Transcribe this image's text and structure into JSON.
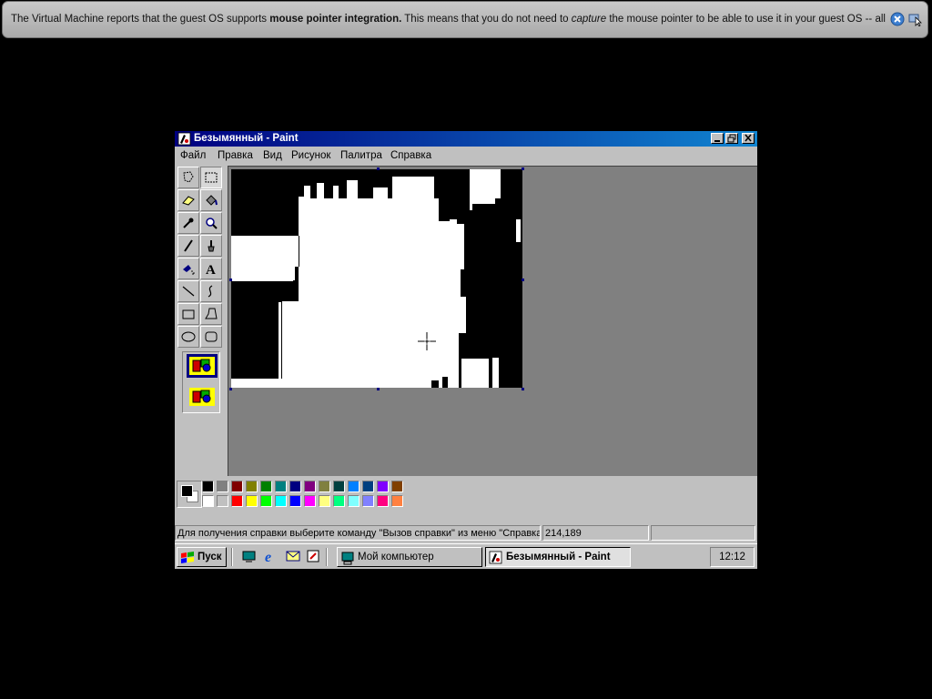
{
  "notification": {
    "part1": "The Virtual Machine reports that the guest OS supports ",
    "bold": "mouse pointer integration.",
    "part2": " This means that you do not need to ",
    "italic": "capture",
    "part3": " the mouse pointer to be able to use it in your guest OS -- all mouse"
  },
  "window": {
    "title": "Безымянный - Paint"
  },
  "menu": {
    "file": "Файл",
    "edit": "Правка",
    "view": "Вид",
    "image": "Рисунок",
    "palette": "Палитра",
    "help": "Справка"
  },
  "tools": [
    "free-select",
    "rect-select",
    "eraser",
    "fill",
    "color-picker",
    "magnifier",
    "pencil",
    "brush",
    "airbrush",
    "text",
    "line",
    "curve",
    "rectangle",
    "polygon",
    "ellipse",
    "rounded-rectangle"
  ],
  "palette": {
    "row1": [
      "#000000",
      "#808080",
      "#800000",
      "#808000",
      "#008000",
      "#008080",
      "#000080",
      "#800080",
      "#808040",
      "#004040",
      "#0080ff",
      "#004080",
      "#8000ff",
      "#804000"
    ],
    "row2": [
      "#ffffff",
      "#c0c0c0",
      "#ff0000",
      "#ffff00",
      "#00ff00",
      "#00ffff",
      "#0000ff",
      "#ff00ff",
      "#ffff80",
      "#00ff80",
      "#80ffff",
      "#8080ff",
      "#ff0080",
      "#ff8040"
    ]
  },
  "status": {
    "help_text": "Для получения справки выберите команду \"Вызов справки\" из меню \"Справка\"",
    "coords": "214,189",
    "size": ""
  },
  "taskbar": {
    "start": "Пуск",
    "my_computer": "Мой компьютер",
    "paint": "Безымянный - Paint",
    "clock": "12:12"
  }
}
